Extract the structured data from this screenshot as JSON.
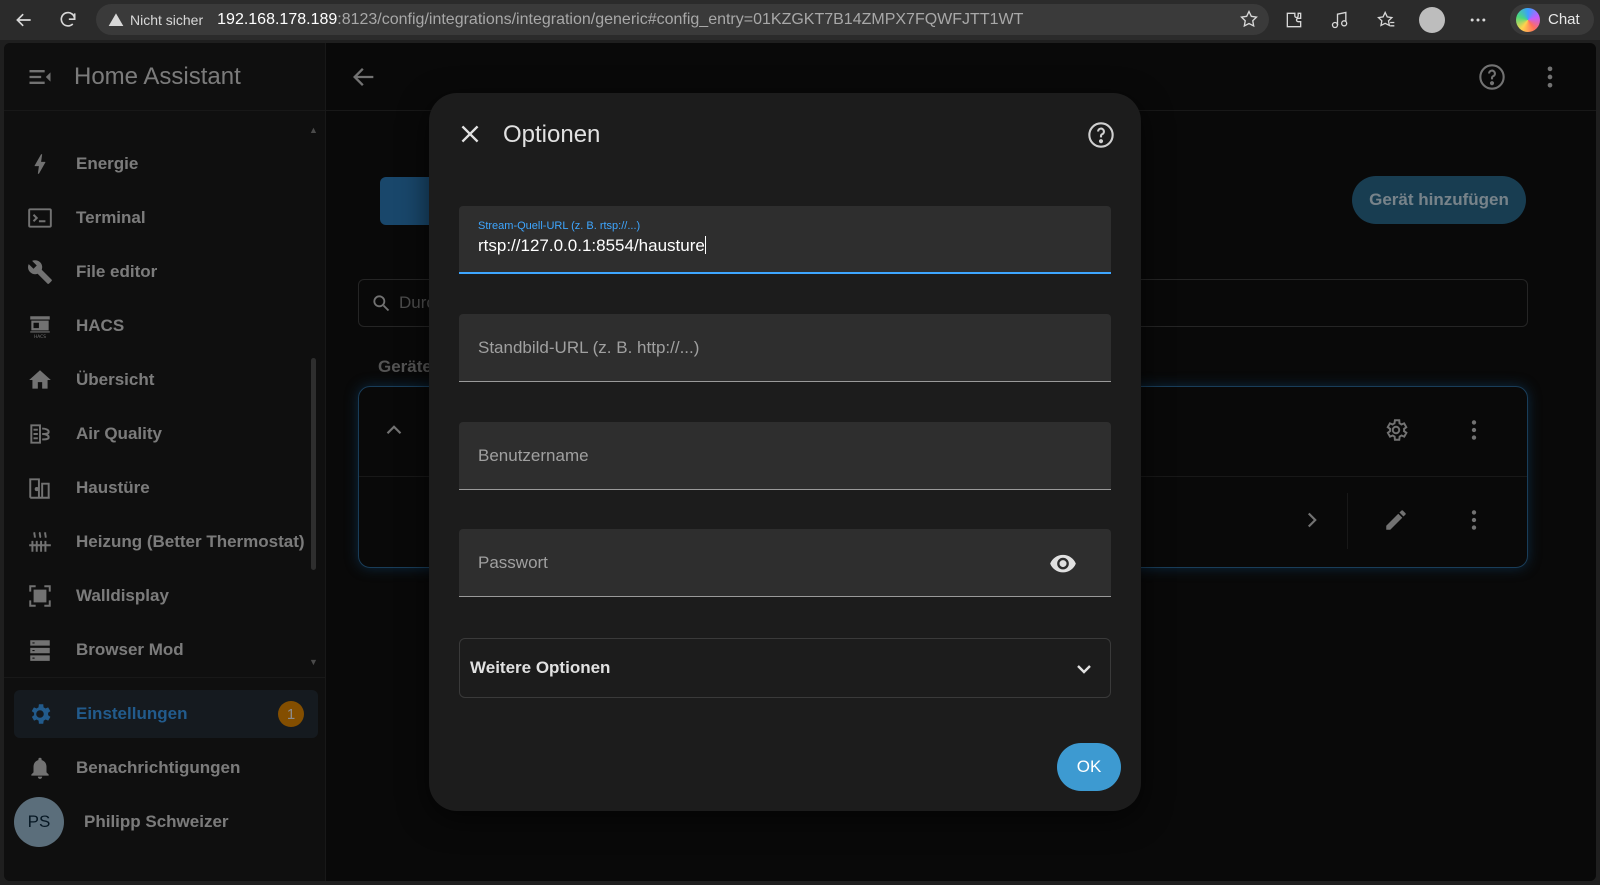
{
  "browser": {
    "security_label": "Nicht sicher",
    "url_host": "192.168.178.189",
    "url_path": ":8123/config/integrations/integration/generic#config_entry=01KZGKT7B14ZMPX7FQWFJTT1WT",
    "chat_label": "Chat"
  },
  "sidebar": {
    "app_title": "Home Assistant",
    "items": [
      {
        "label": "Energie",
        "icon": "lightning-icon"
      },
      {
        "label": "Terminal",
        "icon": "terminal-icon"
      },
      {
        "label": "File editor",
        "icon": "wrench-icon"
      },
      {
        "label": "HACS",
        "icon": "hacs-icon"
      },
      {
        "label": "Übersicht",
        "icon": "home-icon"
      },
      {
        "label": "Air Quality",
        "icon": "air-quality-icon"
      },
      {
        "label": "Haustüre",
        "icon": "door-icon"
      },
      {
        "label": "Heizung (Better Thermostat)",
        "icon": "radiator-icon"
      },
      {
        "label": "Walldisplay",
        "icon": "fullscreen-icon"
      },
      {
        "label": "Browser Mod",
        "icon": "server-icon"
      }
    ],
    "settings": {
      "label": "Einstellungen",
      "badge": "1"
    },
    "notifications": {
      "label": "Benachrichtigungen"
    },
    "user": {
      "initials": "PS",
      "name": "Philipp Schweizer"
    }
  },
  "main": {
    "add_device_label": "Gerät hinzufügen",
    "search_placeholder": "Durc",
    "section_label": "Geräte"
  },
  "dialog": {
    "title": "Optionen",
    "stream_url": {
      "label": "Stream-Quell-URL (z. B. rtsp://...)",
      "value": "rtsp://127.0.0.1:8554/hausture"
    },
    "still_image_url": {
      "placeholder": "Standbild-URL (z. B. http://...)"
    },
    "username": {
      "placeholder": "Benutzername"
    },
    "password": {
      "placeholder": "Passwort"
    },
    "more_options_label": "Weitere Optionen",
    "ok_label": "OK"
  },
  "colors": {
    "accent": "#3ea6ff",
    "badge": "#ef8f00",
    "ok_button": "#3d9ad1"
  }
}
